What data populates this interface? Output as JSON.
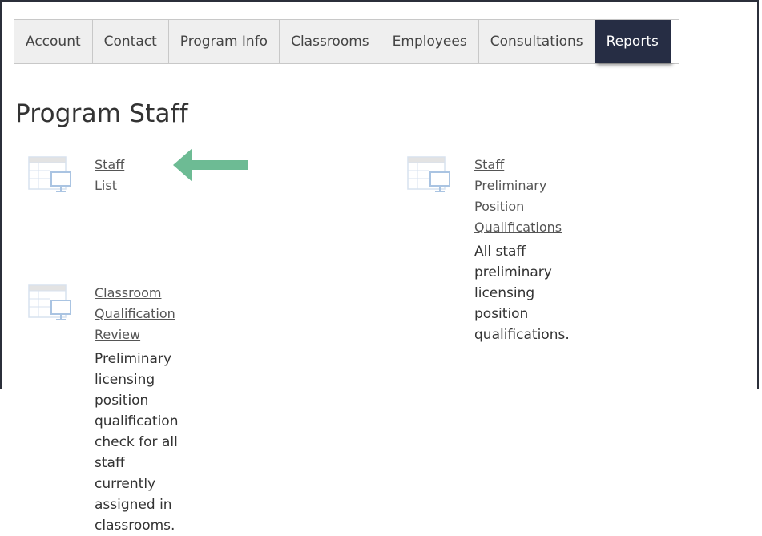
{
  "tabs": [
    {
      "label": "Account",
      "active": false
    },
    {
      "label": "Contact",
      "active": false
    },
    {
      "label": "Program Info",
      "active": false
    },
    {
      "label": "Classrooms",
      "active": false
    },
    {
      "label": "Employees",
      "active": false
    },
    {
      "label": "Consultations",
      "active": false
    },
    {
      "label": "Reports",
      "active": true
    }
  ],
  "page": {
    "title": "Program Staff"
  },
  "reports": {
    "staff_list": {
      "link": "Staff List",
      "desc": ""
    },
    "staff_preliminary": {
      "link_line1": "Staff Preliminary Position",
      "link_line2": "Qualifications",
      "desc_line1": "All staff preliminary licensing position",
      "desc_line2": "qualifications."
    },
    "classroom_review": {
      "link": "Classroom Qualification Review",
      "desc_line1": "Preliminary licensing position",
      "desc_line2": "qualification check for all staff",
      "desc_line3": "currently assigned in classrooms."
    }
  },
  "colors": {
    "active_tab_bg": "#262d44",
    "arrow": "#6dbb94",
    "icon": "#d7e2ef"
  },
  "icons": {
    "report_icon": "spreadsheet-monitor-icon",
    "arrow": "arrow-left-icon"
  }
}
